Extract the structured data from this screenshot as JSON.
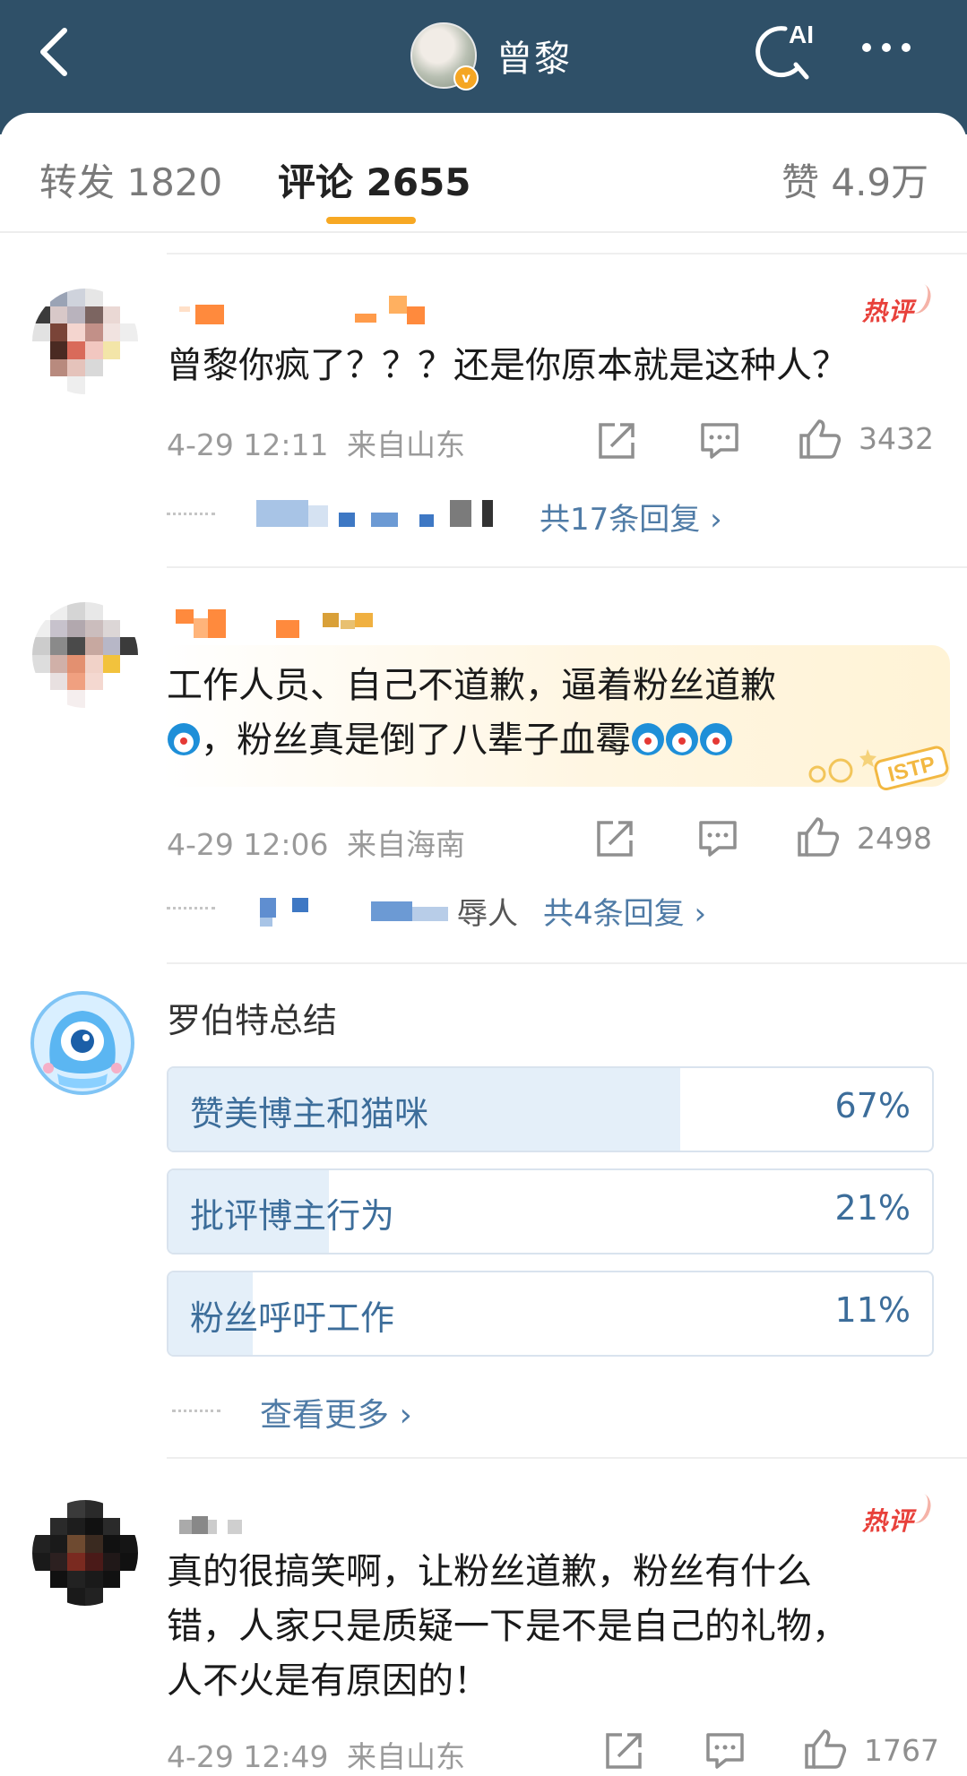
{
  "header": {
    "title": "曾黎",
    "back_icon": "chevron-left-icon",
    "ai_label": "AI",
    "ai_icon": "ai-search-icon",
    "more_icon": "more-dots-icon",
    "verified_badge": "v",
    "bg_color": "#2f5068"
  },
  "tabs": [
    {
      "label": "转发 1820",
      "active": false
    },
    {
      "label": "评论 2655",
      "active": true
    },
    {
      "label": "赞 4.9万",
      "active": false
    }
  ],
  "accent_color": "#f7a823",
  "comments": [
    {
      "hot_label": "热评",
      "text": "曾黎你疯了？？？还是你原本就是这种人？",
      "time": "4-29 12:11",
      "location": "来自山东",
      "likes": "3432",
      "replies_link": "共17条回复 ›"
    },
    {
      "text_line1": "工作人员、自己不道歉，逼着粉丝道歉",
      "text_line2": "，粉丝真是倒了八辈子血霉",
      "time": "4-29 12:06",
      "location": "来自海南",
      "likes": "2498",
      "reply_name_tail": "‍辱人",
      "replies_link": "共4条回复 ›",
      "badge": "ISTP"
    },
    {
      "hot_label": "热评",
      "text_line1": "真的很搞笑啊，让粉丝道歉，粉丝有什么",
      "text_line2": "错，人家只是质疑一下是不是自己的礼物，",
      "text_line3": "人不火是有原因的！",
      "time": "4-29 12:49",
      "location": "来自山东",
      "likes": "1767"
    }
  ],
  "poll": {
    "author": "罗伯特总结",
    "options": [
      {
        "label": "赞美博主和猫咪",
        "pct_label": "67%",
        "fraction": 0.67
      },
      {
        "label": "批评博主行为",
        "pct_label": "21%",
        "fraction": 0.21
      },
      {
        "label": "粉丝呼吁工作",
        "pct_label": "11%",
        "fraction": 0.11
      }
    ],
    "see_more": "查看更多 ›"
  },
  "icons": {
    "repost": "share-icon",
    "comment": "comment-icon",
    "like": "thumbs-up-icon"
  },
  "link_color": "#4f7ba6",
  "hot_color": "#e8413b"
}
